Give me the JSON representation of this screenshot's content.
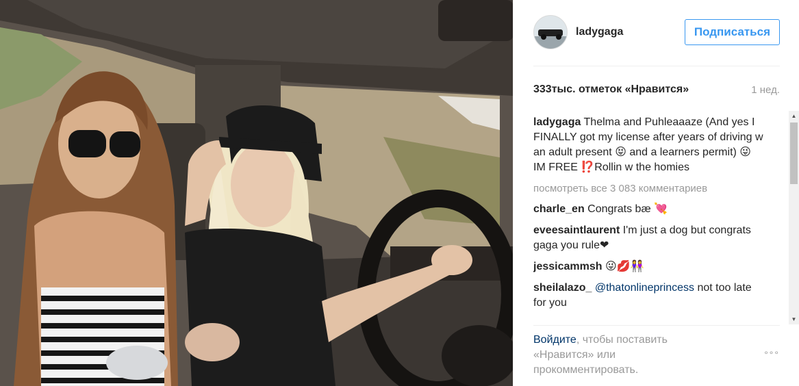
{
  "post": {
    "author": "ladygaga",
    "follow_label": "Подписаться",
    "likes": "333тыс. отметок «Нравится»",
    "time": "1 нед."
  },
  "caption": {
    "user": "ladygaga",
    "text": "Thelma and Puhleaaaze (And yes I FINALLY got my license after years of driving w an adult present 😝 and a learners permit) 😜 IM FREE ⁉️Rollin w the homies"
  },
  "view_all": "посмотреть все 3 083 комментариев",
  "comments": [
    {
      "user": "charle_en",
      "text": "Congrats bæ 💘"
    },
    {
      "user": "eveesaintlaurent",
      "text": "I'm just a dog but congrats gaga you rule❤"
    },
    {
      "user": "jessicammsh",
      "text": "😜💋👭"
    },
    {
      "user": "sheilalazo_",
      "mention": "@thatonlineprincess",
      "text": " not too late for you"
    }
  ],
  "footer": {
    "login_link": "Войдите",
    "login_rest": ", чтобы поставить «Нравится» или прокомментировать.",
    "more": "°°°"
  },
  "icons": {
    "more": "more-options-icon",
    "scroll_up": "scroll-up-arrow-icon",
    "scroll_down": "scroll-down-arrow-icon"
  },
  "colors": {
    "accent": "#3897f0",
    "link": "#003569",
    "muted": "#999999",
    "text": "#262626"
  }
}
